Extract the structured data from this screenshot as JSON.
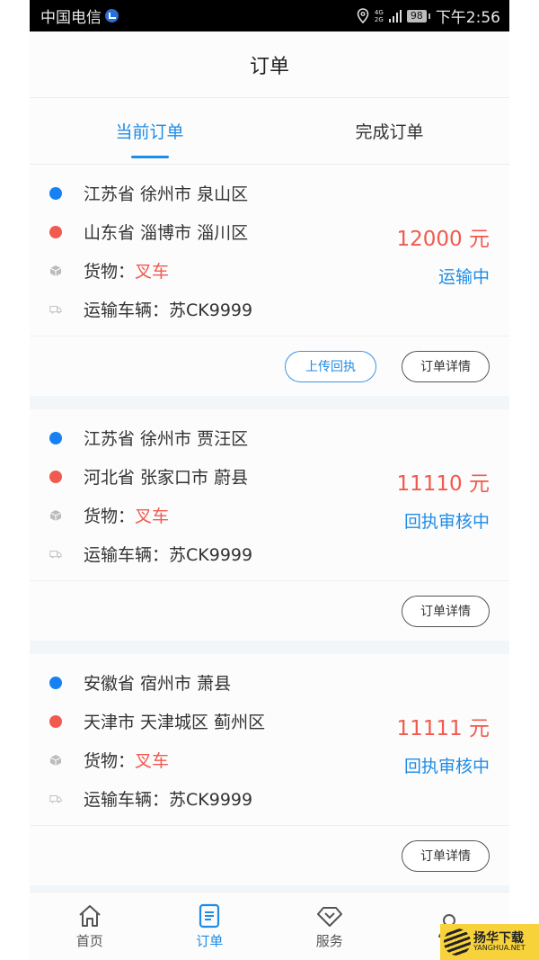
{
  "statusbar": {
    "carrier": "中国电信",
    "network_top": "4G",
    "network_bottom": "2G",
    "battery": "98",
    "time": "下午2:56"
  },
  "navbar": {
    "title": "订单"
  },
  "tabs": [
    {
      "label": "当前订单",
      "active": true
    },
    {
      "label": "完成订单",
      "active": false
    }
  ],
  "labels": {
    "cargo_prefix": "货物：",
    "vehicle_prefix": "运输车辆：",
    "currency": "元"
  },
  "orders": [
    {
      "origin": "江苏省 徐州市 泉山区",
      "destination": "山东省 淄博市 淄川区",
      "price": "12000 元",
      "cargo": "叉车",
      "status": "运输中",
      "vehicle": "苏CK9999",
      "buttons": [
        "上传回执",
        "订单详情"
      ]
    },
    {
      "origin": "江苏省 徐州市 贾汪区",
      "destination": "河北省 张家口市 蔚县",
      "price": "11110 元",
      "cargo": "叉车",
      "status": "回执审核中",
      "vehicle": "苏CK9999",
      "buttons": [
        "订单详情"
      ]
    },
    {
      "origin": "安徽省 宿州市 萧县",
      "destination": "天津市 天津城区 蓟州区",
      "price": "11111 元",
      "cargo": "叉车",
      "status": "回执审核中",
      "vehicle": "苏CK9999",
      "buttons": [
        "订单详情"
      ]
    }
  ],
  "tabbar": [
    {
      "label": "首页",
      "icon": "home-icon",
      "active": false
    },
    {
      "label": "订单",
      "icon": "order-icon",
      "active": true
    },
    {
      "label": "服务",
      "icon": "service-icon",
      "active": false
    },
    {
      "label": "",
      "icon": "user-icon",
      "active": false
    }
  ],
  "watermark": {
    "cn": "扬华下载",
    "en": "YANGHUA.NET"
  },
  "colors": {
    "accent": "#1f8ce6",
    "price_red": "#f05a4f",
    "origin_dot": "#1681f2",
    "destination_dot": "#f05a4f"
  }
}
